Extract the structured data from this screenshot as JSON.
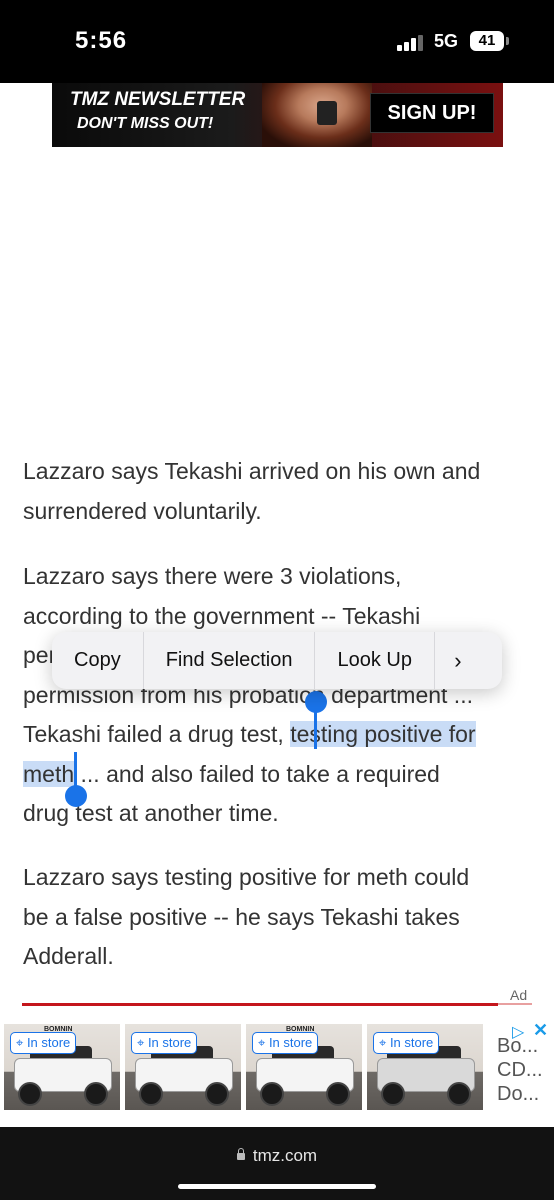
{
  "status_bar": {
    "time": "5:56",
    "network": "5G",
    "battery": "41"
  },
  "banner": {
    "title": "TMZ NEWSLETTER",
    "subtitle": "DON'T MISS OUT!",
    "cta": "SIGN UP!"
  },
  "article": {
    "p1": [
      "Lazzaro says Tekashi arrived on his own and",
      "surrendered voluntarily."
    ],
    "p2": {
      "l1": "Lazzaro says there were 3 violations,",
      "l2": "according to the government -- Tekashi",
      "l3": "per",
      "l4": "permission from his probation department ...",
      "l5_pre": "Tekashi failed a drug test, ",
      "l5_sel": "testing positive for",
      "l6_sel": "meth",
      "l6_post": " ... and also failed to take a required",
      "l7": "drug test at another time."
    },
    "p3": [
      "Lazzaro says testing positive for meth could",
      "be a false positive -- he says Tekashi takes",
      "Adderall."
    ]
  },
  "context_menu": {
    "items": [
      "Copy",
      "Find Selection",
      "Look Up"
    ],
    "more": "›"
  },
  "ad": {
    "label": "Ad",
    "badge": "In store",
    "brand": "BOMNIN",
    "text_lines": [
      "Bo...",
      "CD...",
      "Do..."
    ]
  },
  "browser": {
    "url": "tmz.com"
  },
  "colors": {
    "selection": "#c9dcf6",
    "handle": "#1a73e8",
    "divider": "#c4161c"
  }
}
